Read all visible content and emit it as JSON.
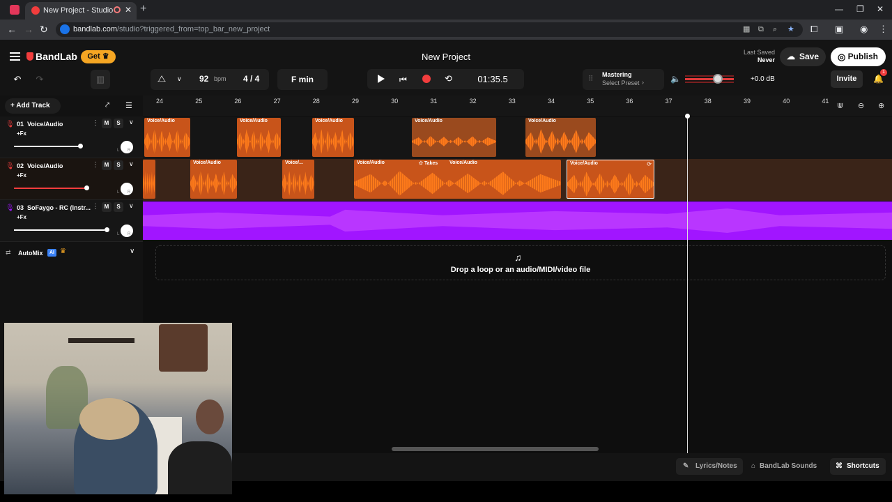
{
  "browser": {
    "tab_title": "New Project - Studio",
    "url_host": "bandlab.com",
    "url_path": "/studio?triggered_from=top_bar_new_project"
  },
  "app": {
    "brand": "BandLab",
    "get_label": "Get",
    "project_title": "New Project",
    "last_saved_label": "Last Saved",
    "last_saved_value": "Never",
    "save_label": "Save",
    "publish_label": "Publish",
    "invite_label": "Invite",
    "notification_count": "1"
  },
  "toolbar": {
    "bpm_value": "92",
    "bpm_unit": "bpm",
    "time_signature": "4 / 4",
    "key": "F min",
    "timecode": "01:35.5",
    "mastering_title": "Mastering",
    "mastering_preset": "Select Preset",
    "volume_db": "+0.0 dB",
    "volume_level": 0.6
  },
  "left_panel": {
    "add_track_label": "Add Track",
    "tracks": [
      {
        "number": "01",
        "name": "Voice/Audio",
        "fx": "+Fx",
        "mute": "M",
        "solo": "S",
        "volume": 0.74
      },
      {
        "number": "02",
        "name": "Voice/Audio",
        "fx": "+Fx",
        "mute": "M",
        "solo": "S",
        "volume": 0.8
      },
      {
        "number": "03",
        "name": "SoFaygo - RC (Instr...",
        "fx": "+Fx",
        "mute": "M",
        "solo": "S",
        "volume": 1.0
      }
    ],
    "automix_label": "AutoMix",
    "automix_ai": "AI"
  },
  "ruler": {
    "ticks": [
      "24",
      "25",
      "26",
      "27",
      "28",
      "29",
      "30",
      "31",
      "32",
      "33",
      "34",
      "35",
      "36",
      "37",
      "38",
      "39",
      "40",
      "41"
    ]
  },
  "clips": {
    "label": "Voice/Audio",
    "short_label": "Voice/...",
    "takes_label": "Takes"
  },
  "dropzone_text": "Drop a loop or an audio/MIDI/video file",
  "bottom": {
    "lyrics_label": "Lyrics/Notes",
    "sounds_label": "BandLab Sounds",
    "shortcuts_label": "Shortcuts"
  },
  "colors": {
    "accent": "#f23d3d",
    "clip_orange": "#ff7a1a",
    "instrumental_purple": "#a115ff",
    "get_button": "#f5a623"
  }
}
